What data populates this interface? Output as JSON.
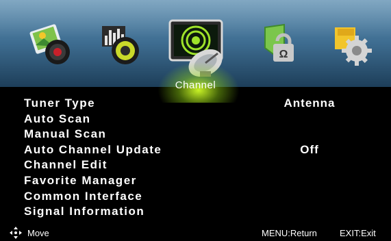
{
  "menu": {
    "title": "Channel",
    "items": [
      {
        "label": "Tuner Type",
        "value": "Antenna"
      },
      {
        "label": "Auto Scan",
        "value": ""
      },
      {
        "label": "Manual Scan",
        "value": ""
      },
      {
        "label": "Auto Channel Update",
        "value": "Off"
      },
      {
        "label": "Channel Edit",
        "value": ""
      },
      {
        "label": "Favorite Manager",
        "value": ""
      },
      {
        "label": "Common Interface",
        "value": ""
      },
      {
        "label": "Signal Information",
        "value": ""
      }
    ]
  },
  "topbar": {
    "icons": [
      "picture-icon",
      "sound-icon",
      "channel-icon",
      "lock-icon",
      "setup-icon"
    ],
    "selected": "channel-icon",
    "colors": {
      "bar_top": "#5e8fb1",
      "bar_bottom": "#1d3e59",
      "highlight": "#c8ff28"
    }
  },
  "footer": {
    "move": "Move",
    "menu_return": "MENU:Return",
    "exit": "EXIT:Exit"
  }
}
